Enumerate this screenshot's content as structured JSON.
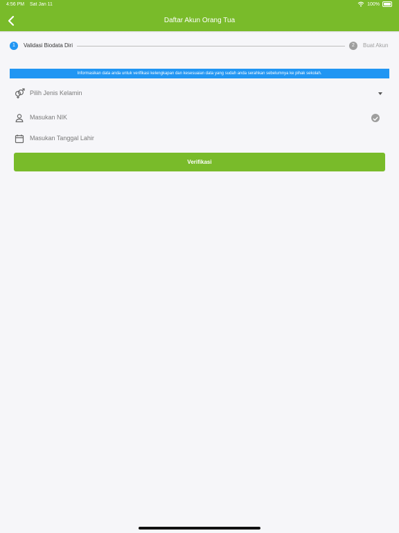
{
  "status_bar": {
    "time": "4:56 PM",
    "date": "Sat Jan 11",
    "battery": "100%"
  },
  "header": {
    "title": "Daftar Akun Orang Tua"
  },
  "stepper": {
    "steps": [
      {
        "number": "1",
        "label": "Validasi Biodata Diri",
        "active": true
      },
      {
        "number": "2",
        "label": "Buat Akun",
        "active": false
      }
    ]
  },
  "info_banner": "Informasikan data anda untuk verifikasi kelengkapan dan kesesuaian data yang sudah anda serahkan sebelumnya ke pihak sekolah.",
  "form": {
    "gender_placeholder": "Pilih Jenis Kelamin",
    "nik_placeholder": "Masukan NIK",
    "dob_placeholder": "Masukan Tanggal Lahir"
  },
  "button": {
    "verify": "Verifikasi"
  },
  "colors": {
    "primary": "#79bb2a",
    "accent": "#2196f3",
    "inactive": "#9e9e9e"
  }
}
